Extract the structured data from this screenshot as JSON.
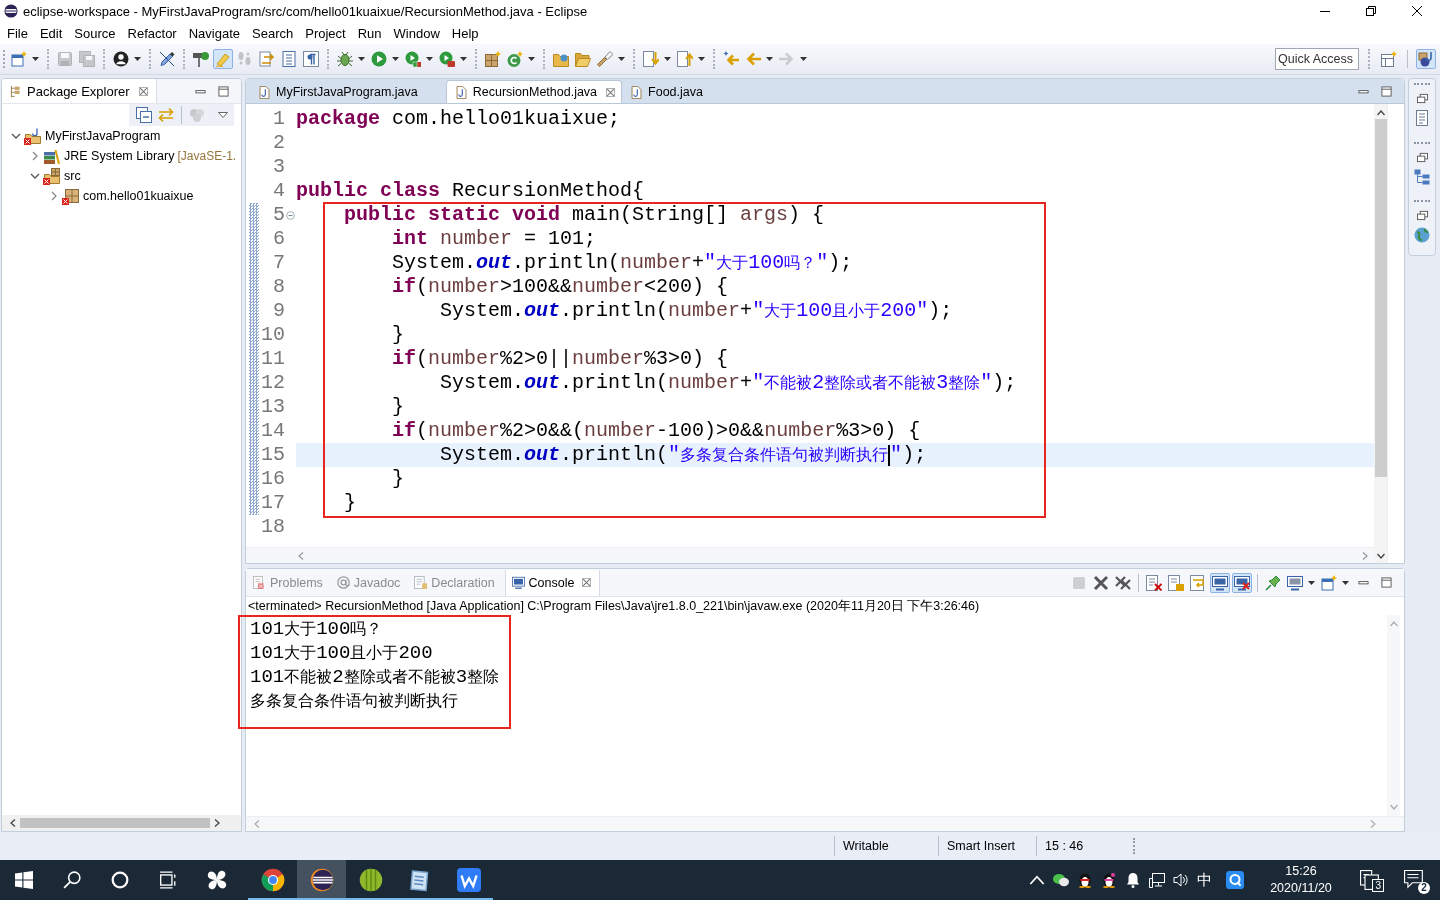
{
  "window": {
    "title": "eclipse-workspace - MyFirstJavaProgram/src/com/hello01kuaixue/RecursionMethod.java - Eclipse"
  },
  "menu": [
    "File",
    "Edit",
    "Source",
    "Refactor",
    "Navigate",
    "Search",
    "Project",
    "Run",
    "Window",
    "Help"
  ],
  "toolbar": [
    [
      {
        "kind": "new",
        "dropdown": true,
        "disabled": false,
        "pressed": false
      }
    ],
    [
      {
        "kind": "save",
        "dropdown": false,
        "disabled": true,
        "pressed": false
      },
      {
        "kind": "saveall",
        "dropdown": false,
        "disabled": true,
        "pressed": false
      }
    ],
    [
      {
        "kind": "profile",
        "dropdown": true,
        "disabled": false,
        "pressed": false
      }
    ],
    [
      {
        "kind": "pen",
        "dropdown": false,
        "disabled": false,
        "pressed": false
      }
    ],
    [
      {
        "kind": "signpost",
        "dropdown": false,
        "disabled": false,
        "pressed": false
      },
      {
        "kind": "highlighter",
        "dropdown": false,
        "disabled": false,
        "pressed": true
      },
      {
        "kind": "footprints",
        "dropdown": false,
        "disabled": true,
        "pressed": false
      },
      {
        "kind": "docarrows",
        "dropdown": false,
        "disabled": false,
        "pressed": false
      },
      {
        "kind": "doclines",
        "dropdown": false,
        "disabled": false,
        "pressed": false
      },
      {
        "kind": "pilcrow",
        "dropdown": false,
        "disabled": false,
        "pressed": false
      }
    ],
    [
      {
        "kind": "bug",
        "dropdown": true,
        "disabled": false,
        "pressed": false
      },
      {
        "kind": "play",
        "dropdown": true,
        "disabled": false,
        "pressed": false
      },
      {
        "kind": "coverage",
        "dropdown": true,
        "disabled": false,
        "pressed": false
      },
      {
        "kind": "tools",
        "dropdown": true,
        "disabled": false,
        "pressed": false
      }
    ],
    [
      {
        "kind": "newpackage",
        "dropdown": false,
        "disabled": false,
        "pressed": false
      },
      {
        "kind": "newclass",
        "dropdown": true,
        "disabled": false,
        "pressed": false
      }
    ],
    [
      {
        "kind": "folder",
        "dropdown": false,
        "disabled": false,
        "pressed": false
      },
      {
        "kind": "openfolder",
        "dropdown": false,
        "disabled": false,
        "pressed": false
      },
      {
        "kind": "flashlight",
        "dropdown": true,
        "disabled": false,
        "pressed": false
      }
    ],
    [
      {
        "kind": "nextmark",
        "dropdown": true,
        "disabled": false,
        "pressed": false
      },
      {
        "kind": "prevmark",
        "dropdown": true,
        "disabled": false,
        "pressed": false
      }
    ],
    [
      {
        "kind": "lastedit",
        "dropdown": false,
        "disabled": false,
        "pressed": false
      },
      {
        "kind": "back",
        "dropdown": true,
        "disabled": false,
        "pressed": false
      },
      {
        "kind": "forward",
        "dropdown": true,
        "disabled": true,
        "pressed": false
      }
    ]
  ],
  "quick_access": {
    "placeholder": "Quick Access"
  },
  "perspectives": [
    {
      "kind": "openperspective",
      "selected": false
    },
    {
      "kind": "java",
      "selected": true
    }
  ],
  "package_explorer": {
    "title": "Package Explorer",
    "toolbar": [
      {
        "kind": "collapseall",
        "disabled": false
      },
      {
        "kind": "link",
        "disabled": false
      },
      {
        "kind": "filters",
        "disabled": true
      }
    ],
    "tree": [
      {
        "label": "MyFirstJavaProgram",
        "kind": "project",
        "expanded": true,
        "error": true,
        "children": [
          {
            "label": "JRE System Library",
            "decoration": "[JavaSE-1.",
            "kind": "library",
            "expanded": false,
            "error": false
          },
          {
            "label": "src",
            "kind": "sourcefolder",
            "expanded": true,
            "error": true,
            "children": [
              {
                "label": "com.hello01kuaixue",
                "kind": "package",
                "expanded": false,
                "error": true
              }
            ]
          }
        ]
      }
    ]
  },
  "editor": {
    "tabs": [
      {
        "label": "MyFirstJavaProgram.java",
        "selected": false
      },
      {
        "label": "RecursionMethod.java",
        "selected": true
      },
      {
        "label": "Food.java",
        "selected": false
      }
    ],
    "lines": [
      {
        "number": "1",
        "tokens": [
          {
            "text": "package",
            "kind": "keyword"
          },
          {
            "text": " com.hello01kuaixue;",
            "kind": "plain"
          }
        ],
        "current": false,
        "foldable": false
      },
      {
        "number": "2",
        "current": false,
        "foldable": false
      },
      {
        "number": "3",
        "current": false,
        "foldable": false
      },
      {
        "number": "4",
        "tokens": [
          {
            "text": "public class",
            "kind": "keyword"
          },
          {
            "text": " RecursionMethod{",
            "kind": "plain"
          }
        ],
        "current": false,
        "foldable": false
      }
    ],
    "method": {
      "range_marker": true,
      "framed": true,
      "lines": [
        {
          "number": "5",
          "tokens": [
            {
              "text": "    public static void",
              "kind": "keyword"
            },
            {
              "text": " main(String[] ",
              "kind": "plain"
            },
            {
              "text": "args",
              "kind": "variable"
            },
            {
              "text": ") {",
              "kind": "plain"
            }
          ],
          "current": false,
          "foldable": true
        },
        {
          "number": "6",
          "tokens": [
            {
              "text": "        int",
              "kind": "keyword"
            },
            {
              "text": " number",
              "kind": "variable"
            },
            {
              "text": " = 101;",
              "kind": "plain"
            }
          ],
          "current": false,
          "foldable": false
        },
        {
          "number": "7",
          "tokens": [
            {
              "text": "        System.",
              "kind": "plain"
            },
            {
              "text": "out",
              "kind": "field"
            },
            {
              "text": ".println(",
              "kind": "plain"
            },
            {
              "text": "number",
              "kind": "variable"
            },
            {
              "text": "+",
              "kind": "plain"
            },
            {
              "text": "\"大于100吗？\"",
              "kind": "string"
            },
            {
              "text": ");",
              "kind": "plain"
            }
          ],
          "current": false,
          "foldable": false
        },
        {
          "number": "8",
          "tokens": [
            {
              "text": "        if",
              "kind": "keyword"
            },
            {
              "text": "(",
              "kind": "plain"
            },
            {
              "text": "number",
              "kind": "variable"
            },
            {
              "text": ">100&&",
              "kind": "plain"
            },
            {
              "text": "number",
              "kind": "variable"
            },
            {
              "text": "<200) {",
              "kind": "plain"
            }
          ],
          "current": false,
          "foldable": false
        },
        {
          "number": "9",
          "tokens": [
            {
              "text": "            System.",
              "kind": "plain"
            },
            {
              "text": "out",
              "kind": "field"
            },
            {
              "text": ".println(",
              "kind": "plain"
            },
            {
              "text": "number",
              "kind": "variable"
            },
            {
              "text": "+",
              "kind": "plain"
            },
            {
              "text": "\"大于100且小于200\"",
              "kind": "string"
            },
            {
              "text": ");",
              "kind": "plain"
            }
          ],
          "current": false,
          "foldable": false
        },
        {
          "number": "10",
          "tokens": [
            {
              "text": "        }",
              "kind": "plain"
            }
          ],
          "current": false,
          "foldable": false
        },
        {
          "number": "11",
          "tokens": [
            {
              "text": "        if",
              "kind": "keyword"
            },
            {
              "text": "(",
              "kind": "plain"
            },
            {
              "text": "number",
              "kind": "variable"
            },
            {
              "text": "%2>0||",
              "kind": "plain"
            },
            {
              "text": "number",
              "kind": "variable"
            },
            {
              "text": "%3>0) {",
              "kind": "plain"
            }
          ],
          "current": false,
          "foldable": false
        },
        {
          "number": "12",
          "tokens": [
            {
              "text": "            System.",
              "kind": "plain"
            },
            {
              "text": "out",
              "kind": "field"
            },
            {
              "text": ".println(",
              "kind": "plain"
            },
            {
              "text": "number",
              "kind": "variable"
            },
            {
              "text": "+",
              "kind": "plain"
            },
            {
              "text": "\"不能被2整除或者不能被3整除\"",
              "kind": "string"
            },
            {
              "text": ");",
              "kind": "plain"
            }
          ],
          "current": false,
          "foldable": false
        },
        {
          "number": "13",
          "tokens": [
            {
              "text": "        }",
              "kind": "plain"
            }
          ],
          "current": false,
          "foldable": false
        },
        {
          "number": "14",
          "tokens": [
            {
              "text": "        if",
              "kind": "keyword"
            },
            {
              "text": "(",
              "kind": "plain"
            },
            {
              "text": "number",
              "kind": "variable"
            },
            {
              "text": "%2>0&&(",
              "kind": "plain"
            },
            {
              "text": "number",
              "kind": "variable"
            },
            {
              "text": "-100)>0&&",
              "kind": "plain"
            },
            {
              "text": "number",
              "kind": "variable"
            },
            {
              "text": "%3>0) {",
              "kind": "plain"
            }
          ],
          "current": false,
          "foldable": false
        },
        {
          "number": "15",
          "tokens": [
            {
              "text": "            System.",
              "kind": "plain"
            },
            {
              "text": "out",
              "kind": "field"
            },
            {
              "text": ".println(",
              "kind": "plain"
            },
            {
              "text": "\"多条复合条件语句被判断执行",
              "kind": "string"
            },
            {
              "kind": "caret"
            },
            {
              "text": "\"",
              "kind": "string"
            },
            {
              "text": ");",
              "kind": "plain"
            }
          ],
          "current": true,
          "foldable": false
        },
        {
          "number": "16",
          "tokens": [
            {
              "text": "        }",
              "kind": "plain"
            }
          ],
          "current": false,
          "foldable": false
        },
        {
          "number": "17",
          "tokens": [
            {
              "text": "    }",
              "kind": "plain"
            }
          ],
          "current": false,
          "foldable": false
        }
      ]
    },
    "lines_after": [
      {
        "number": "18",
        "current": false,
        "foldable": false
      }
    ]
  },
  "console": {
    "tabs": [
      {
        "label": "Problems",
        "kind": "problems",
        "selected": false
      },
      {
        "label": "Javadoc",
        "kind": "javadoc",
        "selected": false
      },
      {
        "label": "Declaration",
        "kind": "declaration",
        "selected": false
      },
      {
        "label": "Console",
        "kind": "console",
        "selected": true
      }
    ],
    "toolbar": [
      [
        {
          "kind": "terminate",
          "dropdown": false,
          "disabled": true,
          "pressed": false
        },
        {
          "kind": "remove",
          "dropdown": false,
          "disabled": false,
          "pressed": false
        },
        {
          "kind": "removeall",
          "dropdown": false,
          "disabled": false,
          "pressed": false
        }
      ],
      [
        {
          "kind": "clear",
          "dropdown": false,
          "disabled": false,
          "pressed": false
        },
        {
          "kind": "scrolllock",
          "dropdown": false,
          "disabled": false,
          "pressed": false
        },
        {
          "kind": "wordwrap",
          "dropdown": false,
          "disabled": false,
          "pressed": false
        },
        {
          "kind": "showout",
          "dropdown": false,
          "disabled": false,
          "pressed": true
        },
        {
          "kind": "showerr",
          "dropdown": false,
          "disabled": false,
          "pressed": true
        }
      ],
      [
        {
          "kind": "pin",
          "dropdown": false,
          "disabled": false,
          "pressed": false
        },
        {
          "kind": "display",
          "dropdown": true,
          "disabled": false,
          "pressed": false
        },
        {
          "kind": "openconsole",
          "dropdown": true,
          "disabled": false,
          "pressed": false
        }
      ]
    ],
    "process": "<terminated> RecursionMethod [Java Application] C:\\Program Files\\Java\\jre1.8.0_221\\bin\\javaw.exe (2020年11月20日 下午3:26:46)",
    "output": {
      "framed": true,
      "lines": [
        "101大于100吗？",
        "101大于100且小于200",
        "101不能被2整除或者不能被3整除",
        "多条复合条件语句被判断执行"
      ]
    }
  },
  "status_bar": [
    "Writable",
    "Smart Insert",
    "15 : 46"
  ],
  "taskbar": {
    "apps": [
      {
        "kind": "pinwheel",
        "running": false,
        "selected": false
      },
      {
        "kind": "chrome",
        "running": true,
        "selected": false
      },
      {
        "kind": "eclipse",
        "running": true,
        "selected": true
      },
      {
        "kind": "melon",
        "running": true,
        "selected": false
      },
      {
        "kind": "notepad",
        "running": true,
        "selected": false
      },
      {
        "kind": "wps",
        "running": true,
        "selected": false
      }
    ],
    "tray": {
      "ime": "中",
      "time": "15:26",
      "date": "2020/11/20",
      "action_count": "3",
      "notification_count": "2"
    }
  }
}
